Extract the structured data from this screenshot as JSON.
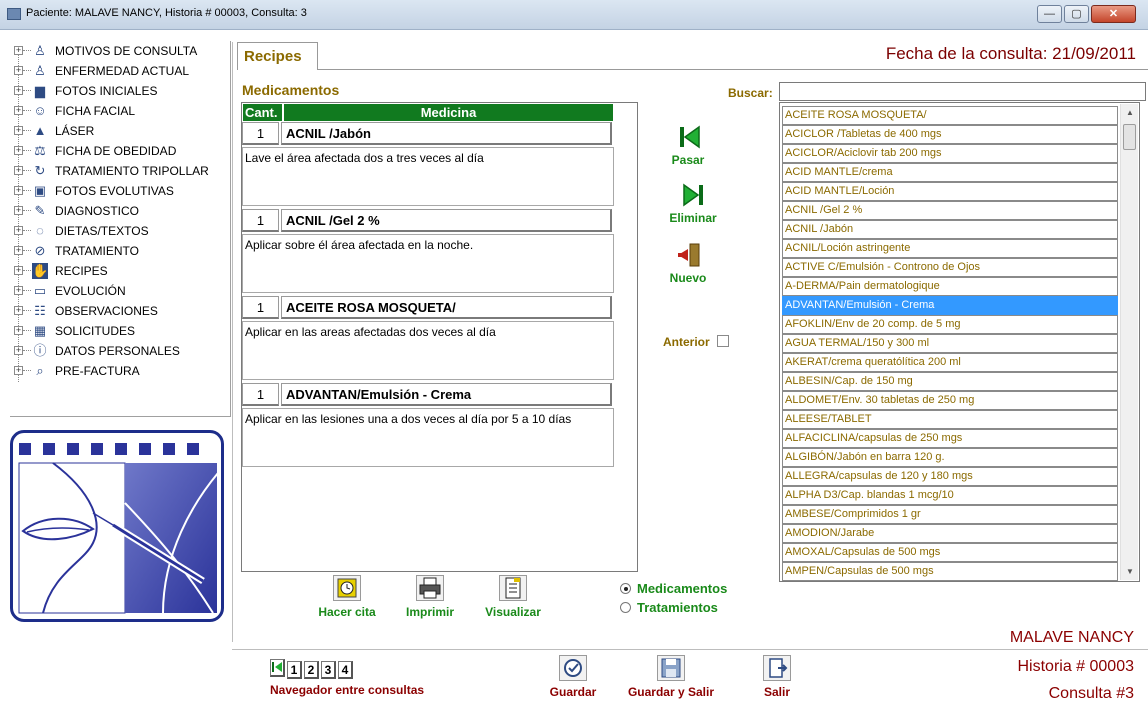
{
  "window": {
    "title": "Paciente: MALAVE  NANCY, Historia # 00003, Consulta: 3",
    "buttons": [
      "—",
      "▢",
      "✕"
    ]
  },
  "tree": {
    "items": [
      {
        "label": "MOTIVOS DE CONSULTA",
        "icon": "person-icon"
      },
      {
        "label": "ENFERMEDAD ACTUAL",
        "icon": "person-icon"
      },
      {
        "label": "FOTOS INICIALES",
        "icon": "document-icon"
      },
      {
        "label": "FICHA FACIAL",
        "icon": "face-icon"
      },
      {
        "label": "LÁSER",
        "icon": "laser-icon"
      },
      {
        "label": "FICHA DE OBEDIDAD",
        "icon": "scale-icon"
      },
      {
        "label": "TRATAMIENTO TRIPOLLAR",
        "icon": "refresh-icon"
      },
      {
        "label": "FOTOS EVOLUTIVAS",
        "icon": "photo-icon"
      },
      {
        "label": "DIAGNOSTICO",
        "icon": "pencil-icon"
      },
      {
        "label": "DIETAS/TEXTOS",
        "icon": "apple-icon"
      },
      {
        "label": "TRATAMIENTO",
        "icon": "check-circle-icon"
      },
      {
        "label": "RECIPES",
        "icon": "hand-icon"
      },
      {
        "label": "EVOLUCIÓN",
        "icon": "chart-icon"
      },
      {
        "label": "OBSERVACIONES",
        "icon": "notes-icon"
      },
      {
        "label": "SOLICITUDES",
        "icon": "grid-icon"
      },
      {
        "label": "DATOS PERSONALES",
        "icon": "info-icon"
      },
      {
        "label": "PRE-FACTURA",
        "icon": "magnifier-icon"
      }
    ]
  },
  "tab": {
    "label": "Recipes"
  },
  "fecha": "Fecha de la consulta:  21/09/2011",
  "medicamentos": {
    "title": "Medicamentos",
    "header_cant": "Cant.",
    "header_medicina": "Medicina",
    "items": [
      {
        "qty": "1",
        "name": "ACNIL /Jabón",
        "desc": "Lave el área afectada dos a tres veces al día"
      },
      {
        "qty": "1",
        "name": "ACNIL /Gel 2 %",
        "desc": "Aplicar sobre él área afectada en la noche."
      },
      {
        "qty": "1",
        "name": "ACEITE ROSA MOSQUETA/",
        "desc": "Aplicar en las areas afectadas dos veces al día"
      },
      {
        "qty": "1",
        "name": "ADVANTAN/Emulsión  -  Crema",
        "desc": "Aplicar en las lesiones una a dos veces al día por 5 a 10 días"
      }
    ]
  },
  "actions": {
    "pasar": "Pasar",
    "eliminar": "Eliminar",
    "nuevo": "Nuevo",
    "anterior": "Anterior"
  },
  "buscar": {
    "label": "Buscar:",
    "value": ""
  },
  "list": {
    "items": [
      "ACEITE ROSA MOSQUETA/",
      "ACICLOR /Tabletas de 400 mgs",
      "ACICLOR/Aciclovir tab 200 mgs",
      "ACID MANTLE/crema",
      "ACID MANTLE/Loción",
      "ACNIL /Gel 2 %",
      "ACNIL /Jabón",
      "ACNIL/Loción astringente",
      "ACTIVE C/Emulsión - Controno de Ojos",
      "A-DERMA/Pain dermatologique",
      "ADVANTAN/Emulsión  -  Crema",
      "AFOKLIN/Env de 20 comp. de 5 mg",
      "AGUA TERMAL/150 y 300 ml",
      "AKERAT/crema queratólítica 200 ml",
      "ALBESIN/Cap. de 150 mg",
      "ALDOMET/Env. 30 tabletas de 250 mg",
      "ALEESE/TABLET",
      "ALFACICLINA/capsulas de 250 mgs",
      "ALGIBÓN/Jabón en barra 120 g.",
      "ALLEGRA/capsulas de 120 y 180 mgs",
      "ALPHA D3/Cap. blandas 1 mcg/10",
      "AMBESE/Comprimidos 1 gr",
      "AMODION/Jarabe",
      "AMOXAL/Capsulas de 500 mgs",
      "AMPEN/Capsulas de 500 mgs"
    ],
    "selected_index": 10
  },
  "bottom": {
    "hacer_cita": "Hacer cita",
    "imprimir": "Imprimir",
    "visualizar": "Visualizar",
    "radio_medicamentos": "Medicamentos",
    "radio_tratamientos": "Tratamientos",
    "guardar": "Guardar",
    "guardar_salir": "Guardar y Salir",
    "salir": "Salir",
    "nav_buttons": [
      "1",
      "2",
      "3",
      "4"
    ],
    "nav_label": "Navegador entre consultas"
  },
  "patient": {
    "name": "MALAVE  NANCY",
    "historia": "Historia # 00003",
    "consulta": "Consulta #3"
  },
  "colors": {
    "accent_gold": "#8b6a00",
    "green": "#117a1f",
    "maroon": "#8b0000",
    "selection": "#3399ff"
  }
}
